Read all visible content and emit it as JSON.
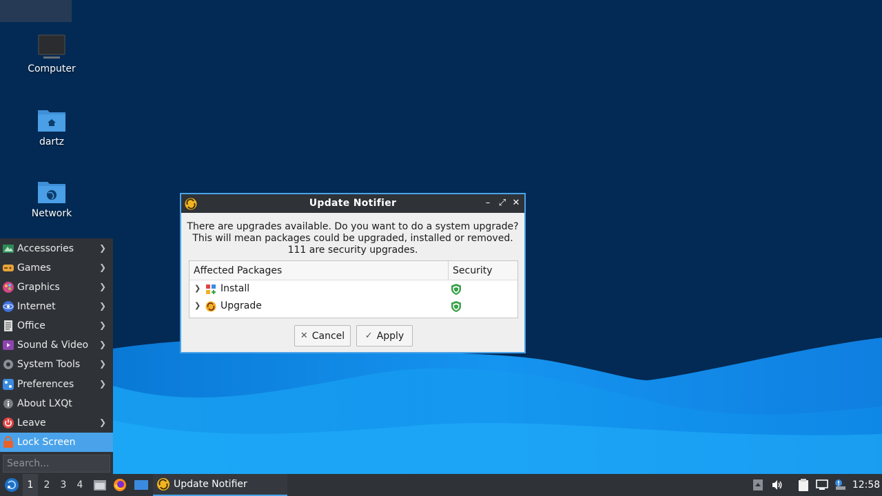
{
  "desktop": {
    "icons": [
      {
        "label": "Computer",
        "icon": "computer-icon"
      },
      {
        "label": "dartz",
        "icon": "home-folder-icon"
      },
      {
        "label": "Network",
        "icon": "network-folder-icon"
      }
    ]
  },
  "app_menu": {
    "items": [
      {
        "label": "Accessories",
        "icon": "accessories-icon",
        "submenu": true
      },
      {
        "label": "Games",
        "icon": "games-icon",
        "submenu": true
      },
      {
        "label": "Graphics",
        "icon": "graphics-icon",
        "submenu": true
      },
      {
        "label": "Internet",
        "icon": "internet-icon",
        "submenu": true
      },
      {
        "label": "Office",
        "icon": "office-icon",
        "submenu": true
      },
      {
        "label": "Sound & Video",
        "icon": "sound-video-icon",
        "submenu": true
      },
      {
        "label": "System Tools",
        "icon": "system-tools-icon",
        "submenu": true
      },
      {
        "label": "Preferences",
        "icon": "preferences-icon",
        "submenu": true
      },
      {
        "label": "About LXQt",
        "icon": "info-icon",
        "submenu": false
      },
      {
        "label": "Leave",
        "icon": "power-icon",
        "submenu": true
      },
      {
        "label": "Lock Screen",
        "icon": "lock-icon",
        "submenu": false,
        "highlighted": true
      }
    ],
    "search_placeholder": "Search..."
  },
  "dialog": {
    "title": "Update Notifier",
    "message_lines": [
      "There are upgrades available. Do you want to do a system upgrade?",
      "This will mean packages could be upgraded, installed or removed.",
      "111 are security upgrades."
    ],
    "table": {
      "columns": [
        "Affected Packages",
        "Security"
      ],
      "rows": [
        {
          "label": "Install",
          "icon": "install-package-icon",
          "security_icon": "shield-check-icon"
        },
        {
          "label": "Upgrade",
          "icon": "upgrade-package-icon",
          "security_icon": "shield-check-icon"
        }
      ]
    },
    "buttons": {
      "cancel": "Cancel",
      "apply": "Apply"
    }
  },
  "taskbar": {
    "workspaces": [
      "1",
      "2",
      "3",
      "4"
    ],
    "current_workspace": "1",
    "task_label": "Update Notifier",
    "clock": "12:58"
  },
  "colors": {
    "accent": "#4aa3ea",
    "panel": "#2f3237",
    "desktop": "#022a54",
    "shield": "#3aa14a"
  }
}
